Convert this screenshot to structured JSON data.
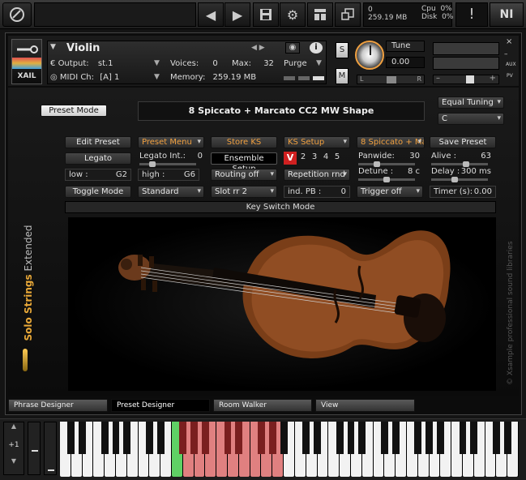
{
  "topbar": {
    "buttons": [
      "kontakt-logo",
      "prev",
      "next",
      "save",
      "settings",
      "view",
      "resize"
    ],
    "memory": {
      "voices": "0",
      "mem": "259.19 MB"
    },
    "cpu": {
      "cpu_label": "Cpu",
      "cpu": "0%",
      "disk_label": "Disk",
      "disk": "0%"
    },
    "warn": "!",
    "ni": "NI"
  },
  "header": {
    "logo_text": "XAIL",
    "instrument_name": "Violin",
    "output_label": "Output:",
    "output_value": "st.1",
    "voices_label": "Voices:",
    "voices_value": "0",
    "max_label": "Max:",
    "max_value": "32",
    "purge_label": "Purge",
    "midi_label": "MIDI Ch:",
    "midi_value": "[A]  1",
    "memory_label": "Memory:",
    "memory_value": "259.19 MB",
    "s_label": "S",
    "m_label": "M",
    "tune_label": "Tune",
    "tune_value": "0.00",
    "pan_l": "L",
    "pan_r": "R",
    "aux": "AUX",
    "pv": "PV"
  },
  "panel": {
    "preset_mode_label": "Preset Mode",
    "preset_display": "8 Spiccato + Marcato CC2 MW Shape",
    "tuning": "Equal Tuning",
    "key": "C",
    "row1": {
      "edit_preset": "Edit Preset",
      "preset_menu": "Preset Menu",
      "store_ks": "Store KS",
      "ks_setup": "KS Setup",
      "preset_name": "8 Spiccato + Marc",
      "save_preset": "Save Preset"
    },
    "row2": {
      "legato": "Legato",
      "legato_int_label": "Legato Int.:",
      "legato_int_value": "0",
      "legato_int_level": 0.2,
      "ensemble_setup": "Ensemble Setup",
      "ks_v": "V",
      "ks_numbers": [
        "2",
        "3",
        "4",
        "5"
      ],
      "panwide_label": "Panwide:",
      "panwide_value": "30",
      "panwide_level": 0.3,
      "alive_label": "Alive :",
      "alive_value": "63",
      "alive_level": 0.63
    },
    "row3": {
      "low_label": "low :",
      "low_value": "G2",
      "high_label": "high :",
      "high_value": "G6",
      "routing": "Routing off",
      "repetition": "Repetition rnd",
      "detune_label": "Detune :",
      "detune_value": "8 c",
      "detune_level": 0.5,
      "delay_label": "Delay :",
      "delay_value": "300 ms",
      "delay_level": 0.4
    },
    "row4": {
      "toggle_mode": "Toggle Mode",
      "standard": "Standard",
      "slot_rr": "Slot rr 2",
      "ind_pb_label": "ind. PB :",
      "ind_pb_value": "0",
      "trigger": "Trigger off",
      "timer_label": "Timer (s):",
      "timer_value": "0.00"
    },
    "keyswitch_bar": "Key Switch Mode",
    "side_title_bold": "Solo Strings",
    "side_title_light": "Extended",
    "copyright": "© Xsample professional sound libraries"
  },
  "tabs": [
    {
      "label": "Phrase Designer",
      "active": false
    },
    {
      "label": "Preset Designer",
      "active": true
    },
    {
      "label": "Room Walker",
      "active": false
    },
    {
      "label": "View",
      "active": false
    }
  ],
  "keyboard": {
    "octave_label": "+1"
  },
  "colors": {
    "accent_orange": "#f0a040",
    "ks_red": "#d02020",
    "key_green": "#5fd065",
    "key_red": "#e08080"
  }
}
